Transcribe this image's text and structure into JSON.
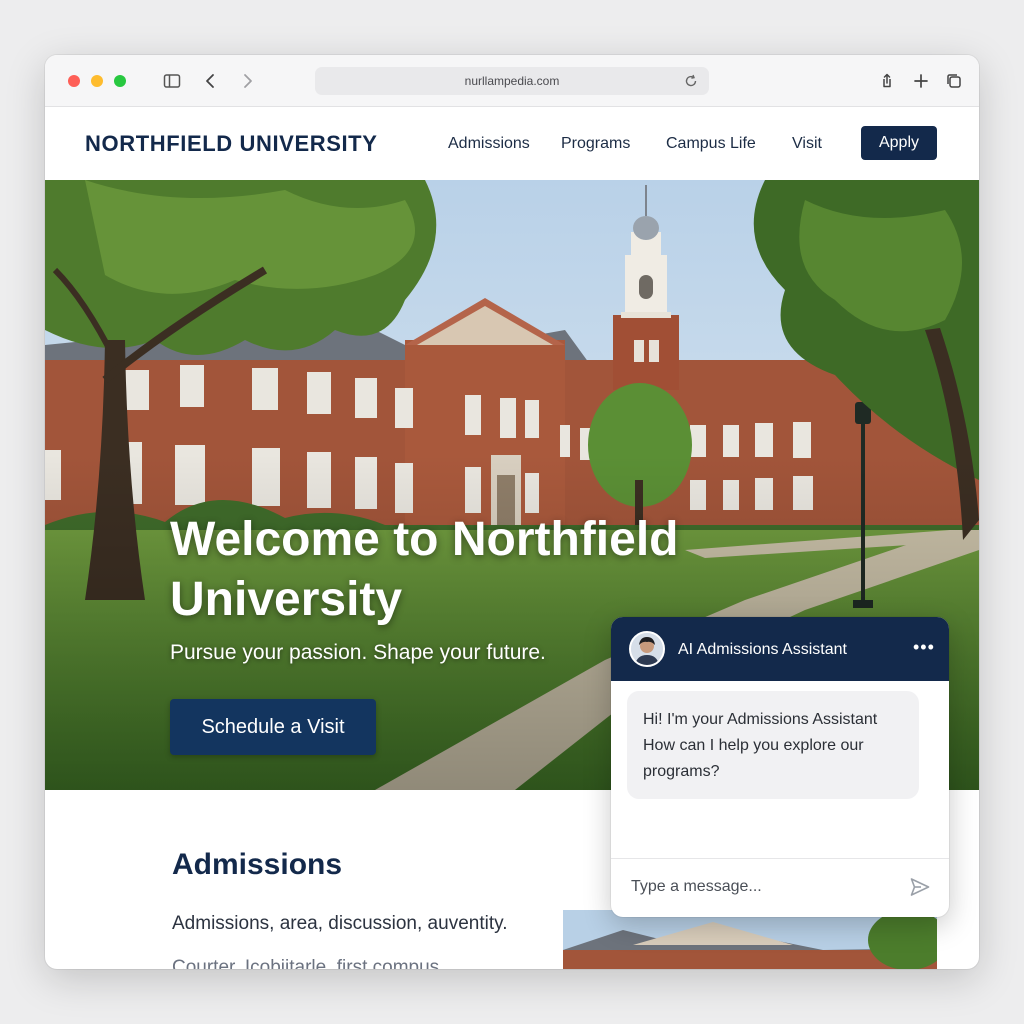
{
  "browser": {
    "url": "nurllampedia.com",
    "icons": [
      "sidebar-icon",
      "back-icon",
      "forward-icon",
      "reload-icon",
      "share-icon",
      "new-tab-icon",
      "tabs-icon"
    ]
  },
  "site": {
    "brand": "NORTHFIELD UNIVERSITY",
    "nav": [
      "Admissions",
      "Programs",
      "Campus Life",
      "Visit"
    ],
    "apply_label": "Apply",
    "colors": {
      "navy": "#13294b",
      "cta": "#13355f"
    }
  },
  "hero": {
    "title": "Welcome to Northfield University",
    "subtitle": "Pursue your passion. Shape your future.",
    "cta_label": "Schedule a Visit"
  },
  "section": {
    "heading": "Admissions",
    "line1": "Admissions, area, discussion, auventity.",
    "line2": "Courter, Icobiitarle, first compus"
  },
  "chat": {
    "title": "AI Admissions Assistant",
    "more_label": "•••",
    "message": "Hi! I'm your Admissions Assistant How can I help you explore our programs?",
    "input_placeholder": "Type a message..."
  }
}
